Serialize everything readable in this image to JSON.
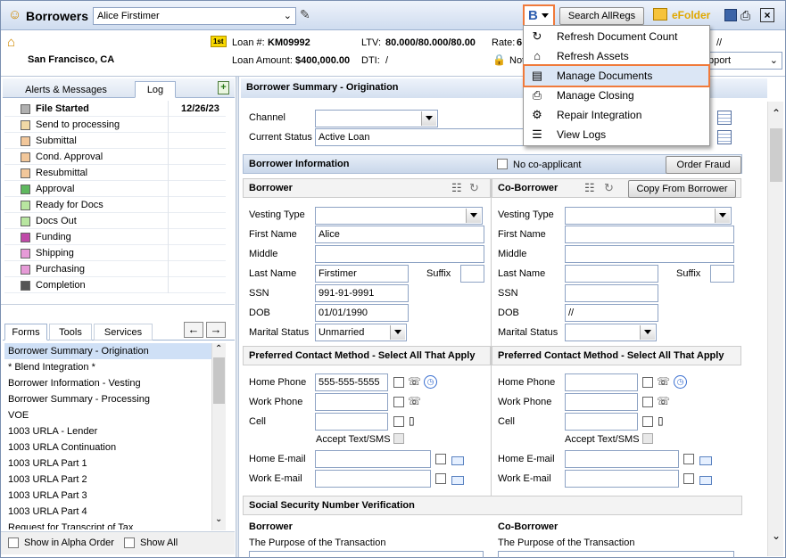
{
  "titlebar": {
    "title": "Borrowers",
    "borrower_select": "Alice Firstimer",
    "search_button": "Search AllRegs",
    "efolder_label": "eFolder"
  },
  "loan_header": {
    "city": "San Francisco, CA",
    "position_badge": "1st",
    "loan_num_label": "Loan #:",
    "loan_num": "KM09992",
    "ltv_label": "LTV:",
    "ltv": "80.000/80.000/80.00",
    "rate_label": "Rate:",
    "rate_partial": "6",
    "loan_amount_label": "Loan Amount:",
    "loan_amount": "$400,000.00",
    "dti_label": "DTI:",
    "dti": "/",
    "note_partial": "Not",
    "slashes": "//",
    "right_combo": "pport"
  },
  "menu": {
    "items": [
      {
        "label": "Refresh Document Count",
        "icon": "refresh-icon"
      },
      {
        "label": "Refresh Assets",
        "icon": "bank-icon"
      },
      {
        "label": "Manage Documents",
        "icon": "documents-icon"
      },
      {
        "label": "Manage Closing",
        "icon": "closing-icon"
      },
      {
        "label": "Repair Integration",
        "icon": "repair-icon"
      },
      {
        "label": "View Logs",
        "icon": "logs-icon"
      }
    ],
    "highlighted_index": 2
  },
  "left": {
    "top_tabs": [
      "Alerts & Messages",
      "Log"
    ],
    "active_top_tab": "Log",
    "milestones": [
      {
        "label": "File Started",
        "date": "12/26/23",
        "color": "#b0b0b0",
        "bold": true
      },
      {
        "label": "Send to processing",
        "date": "",
        "color": "#f1d9a6"
      },
      {
        "label": "Submittal",
        "date": "",
        "color": "#f2c79a"
      },
      {
        "label": "Cond. Approval",
        "date": "",
        "color": "#f2c79a"
      },
      {
        "label": "Resubmittal",
        "date": "",
        "color": "#f2c79a"
      },
      {
        "label": "Approval",
        "date": "",
        "color": "#5fb85f"
      },
      {
        "label": "Ready for Docs",
        "date": "",
        "color": "#b8e6a0"
      },
      {
        "label": "Docs Out",
        "date": "",
        "color": "#b8e6a0"
      },
      {
        "label": "Funding",
        "date": "",
        "color": "#c04aa8"
      },
      {
        "label": "Shipping",
        "date": "",
        "color": "#e69ad7"
      },
      {
        "label": "Purchasing",
        "date": "",
        "color": "#e69ad7"
      },
      {
        "label": "Completion",
        "date": "",
        "color": "#555555"
      }
    ],
    "bottom_tabs": [
      "Forms",
      "Tools",
      "Services"
    ],
    "active_bottom_tab": "Forms",
    "forms": [
      "Borrower Summary - Origination",
      "* Blend Integration *",
      "Borrower Information - Vesting",
      "Borrower Summary - Processing",
      "VOE",
      "1003 URLA - Lender",
      "1003 URLA Continuation",
      "1003 URLA Part 1",
      "1003 URLA Part 2",
      "1003 URLA Part 3",
      "1003 URLA Part 4",
      "Request for Transcript of Tax"
    ],
    "selected_form": 0,
    "show_alpha": "Show in Alpha Order",
    "show_all": "Show All"
  },
  "main": {
    "header": "Borrower Summary - Origination",
    "channel_label": "Channel",
    "channel_value": "",
    "status_label": "Current Status",
    "status_value": "Active Loan",
    "borrower_info_header": "Borrower Information",
    "no_coapp": "No co-applicant",
    "order_fraud": "Order Fraud",
    "borrower_col": "Borrower",
    "coborrower_col": "Co-Borrower",
    "copy_from_borrower": "Copy From Borrower",
    "labels": {
      "vesting": "Vesting Type",
      "first": "First Name",
      "middle": "Middle",
      "last": "Last Name",
      "suffix": "Suffix",
      "ssn": "SSN",
      "dob": "DOB",
      "marital": "Marital Status"
    },
    "borrower": {
      "vesting": "",
      "first": "Alice",
      "middle": "",
      "last": "Firstimer",
      "suffix": "",
      "ssn": "991-91-9991",
      "dob": "01/01/1990",
      "marital": "Unmarried"
    },
    "coborrower": {
      "vesting": "",
      "first": "",
      "middle": "",
      "last": "",
      "suffix": "",
      "ssn": "",
      "dob": "//",
      "marital": ""
    },
    "contact_header": "Preferred Contact Method - Select All That Apply",
    "contact_labels": {
      "home_phone": "Home Phone",
      "work_phone": "Work Phone",
      "cell": "Cell",
      "accept_sms": "Accept Text/SMS",
      "home_email": "Home E-mail",
      "work_email": "Work E-mail"
    },
    "borrower_contact": {
      "home_phone": "555-555-5555",
      "work_phone": "",
      "cell": "",
      "home_email": "",
      "work_email": ""
    },
    "ssn_verification_header": "Social Security Number Verification",
    "ssn_borrower": "Borrower",
    "ssn_coborrower": "Co-Borrower",
    "purpose_label": "The Purpose of the Transaction"
  }
}
